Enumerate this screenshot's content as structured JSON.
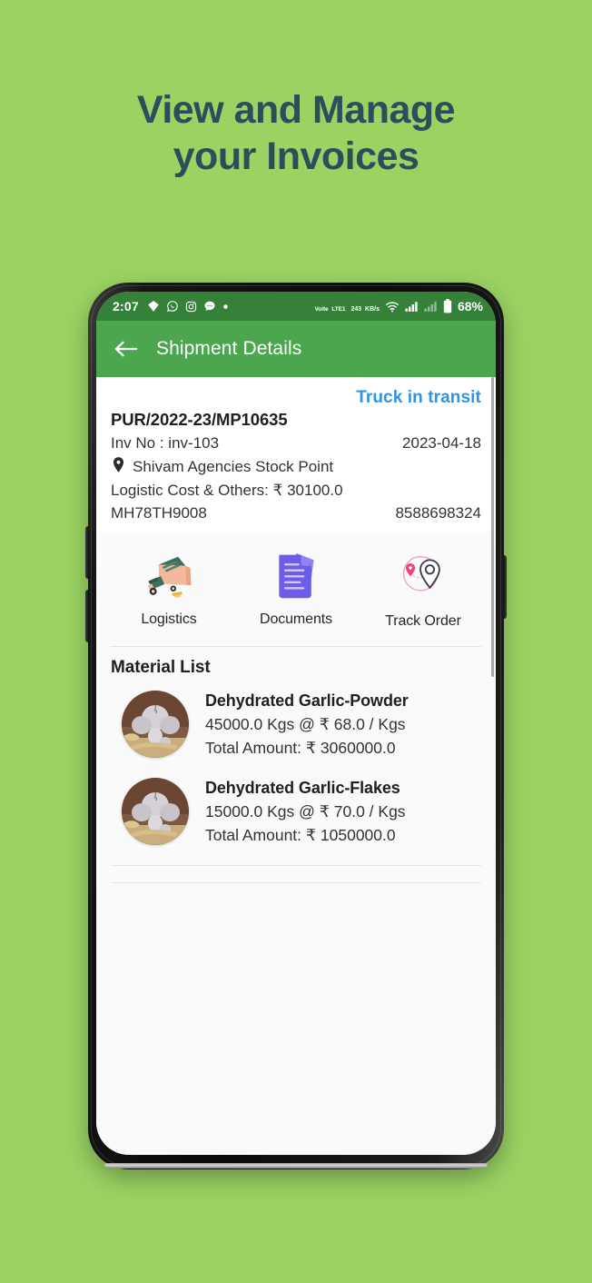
{
  "promo": {
    "line1": "View and Manage",
    "line2": "your Invoices",
    "heading_color": "#2b4d5c",
    "background_color": "#9bd363"
  },
  "status_bar": {
    "time": "2:07",
    "left_icons": [
      "threads-icon",
      "whatsapp-icon",
      "instagram-icon",
      "messages-icon",
      "dot-icon"
    ],
    "network_type": "Volte",
    "network_type_sub": "LTE1",
    "data_rate": "243",
    "data_rate_unit": "KB/s",
    "battery": "68%",
    "background_color": "#36813a"
  },
  "app_bar": {
    "title": "Shipment Details",
    "back_icon": "arrow-left-icon",
    "background_color": "#4ba64e"
  },
  "invoice": {
    "status": "Truck in transit",
    "status_color": "#2f94e8",
    "po_number": "PUR/2022-23/MP10635",
    "inv_no": "Inv No : inv-103",
    "date": "2023-04-18",
    "location": "Shivam Agencies Stock Point",
    "logistic_cost": "Logistic Cost & Others: ₹ 30100.0",
    "truck_number": "MH78TH9008",
    "phone": "8588698324"
  },
  "actions": [
    {
      "label": "Logistics",
      "icon": "truck-icon"
    },
    {
      "label": "Documents",
      "icon": "documents-icon"
    },
    {
      "label": "Track Order",
      "icon": "track-order-icon"
    }
  ],
  "material_list": {
    "title": "Material List",
    "items": [
      {
        "name": "Dehydrated Garlic-Powder",
        "quantity": "45000.0 Kgs @  ₹ 68.0 / Kgs",
        "total": "Total Amount:  ₹ 3060000.0",
        "thumbnail": "garlic-photo"
      },
      {
        "name": "Dehydrated Garlic-Flakes",
        "quantity": "15000.0 Kgs @  ₹ 70.0 / Kgs",
        "total": "Total Amount:  ₹ 1050000.0",
        "thumbnail": "garlic-photo"
      }
    ]
  }
}
